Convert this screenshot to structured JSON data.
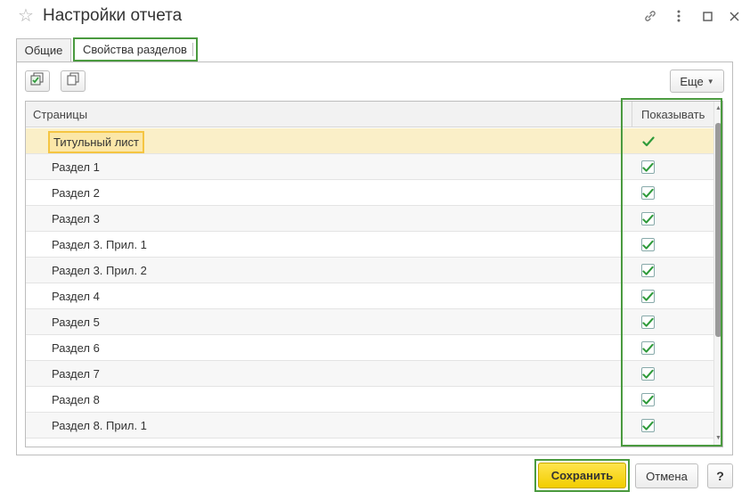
{
  "window": {
    "title": "Настройки отчета"
  },
  "icons": {
    "favorite": "star-icon",
    "link": "link-icon",
    "more": "more-vertical-icon",
    "maximize": "maximize-icon",
    "close": "close-icon",
    "check_all": "check-all-icon",
    "copy": "copy-icon"
  },
  "tabs": [
    {
      "label": "Общие",
      "active": false
    },
    {
      "label": "Свойства разделов",
      "active": true
    }
  ],
  "toolbar": {
    "more_label": "Еще"
  },
  "table": {
    "columns": [
      "Страницы",
      "Показывать"
    ],
    "rows": [
      {
        "label": "Титульный лист",
        "show": true,
        "selected": true
      },
      {
        "label": "Раздел 1",
        "show": true
      },
      {
        "label": "Раздел 2",
        "show": true
      },
      {
        "label": "Раздел 3",
        "show": true
      },
      {
        "label": "Раздел 3. Прил. 1",
        "show": true
      },
      {
        "label": "Раздел 3. Прил. 2",
        "show": true
      },
      {
        "label": "Раздел 4",
        "show": true
      },
      {
        "label": "Раздел 5",
        "show": true
      },
      {
        "label": "Раздел 6",
        "show": true
      },
      {
        "label": "Раздел 7",
        "show": true
      },
      {
        "label": "Раздел 8",
        "show": true
      },
      {
        "label": "Раздел 8. Прил. 1",
        "show": true
      }
    ]
  },
  "footer": {
    "save_label": "Сохранить",
    "cancel_label": "Отмена",
    "help_label": "?"
  },
  "colors": {
    "accent_green": "#4a9a3f",
    "save_yellow": "#f2cd00",
    "selected_row": "#faefc8",
    "check_green": "#2e9a3a"
  }
}
